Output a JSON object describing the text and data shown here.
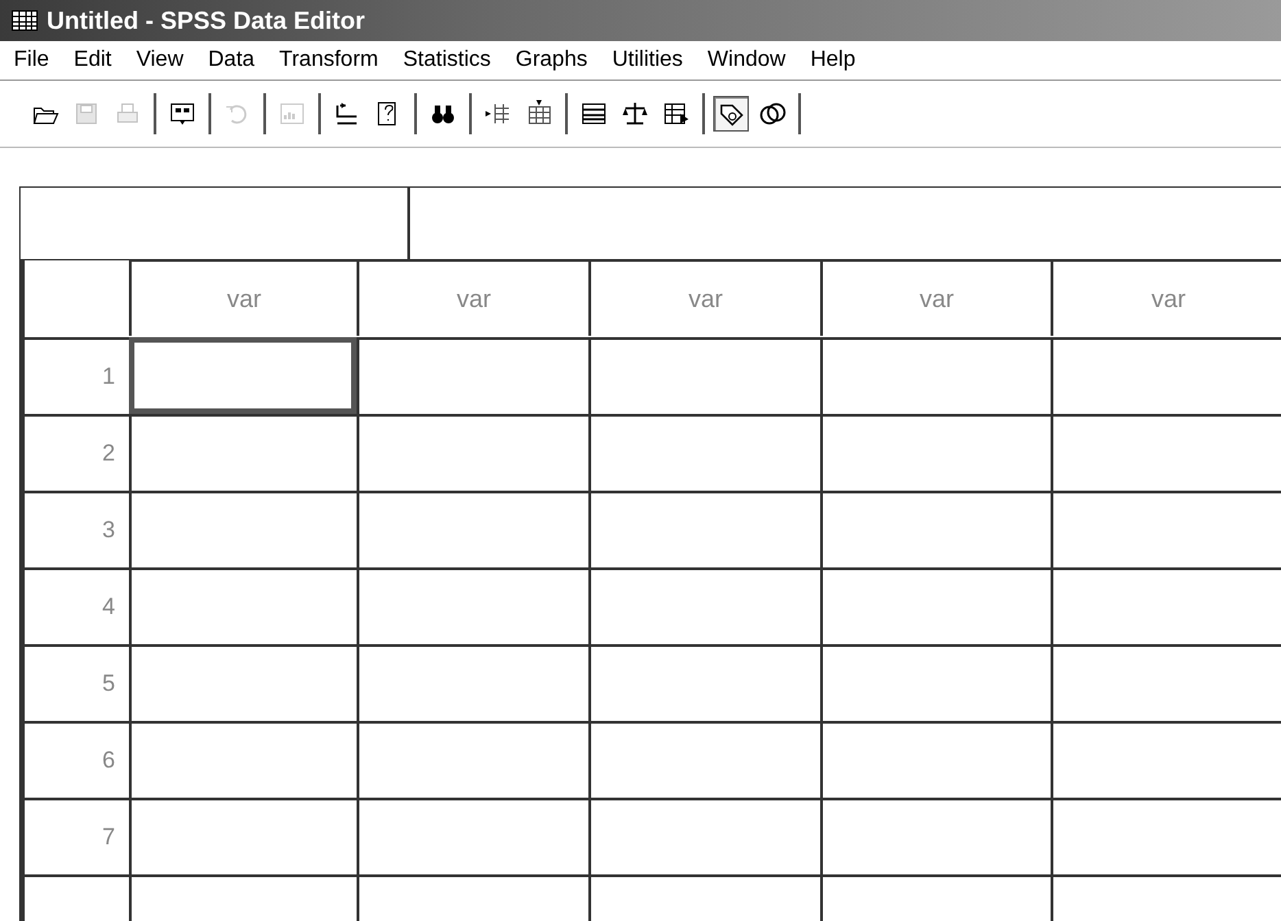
{
  "window": {
    "title": "Untitled - SPSS Data Editor"
  },
  "menu": [
    "File",
    "Edit",
    "View",
    "Data",
    "Transform",
    "Statistics",
    "Graphs",
    "Utilities",
    "Window",
    "Help"
  ],
  "toolbar": [
    [
      {
        "disabled": false,
        "pressed": false
      },
      {
        "disabled": true,
        "pressed": false
      },
      {
        "disabled": true,
        "pressed": false
      }
    ],
    [
      {
        "disabled": false,
        "pressed": false
      }
    ],
    [
      {
        "disabled": true,
        "pressed": false
      }
    ],
    [
      {
        "disabled": true,
        "pressed": false
      }
    ],
    [
      {
        "disabled": false,
        "pressed": false
      },
      {
        "disabled": false,
        "pressed": false
      }
    ],
    [
      {
        "disabled": false,
        "pressed": false
      }
    ],
    [
      {
        "disabled": false,
        "pressed": false
      },
      {
        "disabled": false,
        "pressed": false
      }
    ],
    [
      {
        "disabled": false,
        "pressed": false
      },
      {
        "disabled": false,
        "pressed": false
      },
      {
        "disabled": false,
        "pressed": false
      }
    ],
    [
      {
        "disabled": false,
        "pressed": true
      },
      {
        "disabled": false,
        "pressed": false
      }
    ]
  ],
  "grid": {
    "columns": [
      "var",
      "var",
      "var",
      "var",
      "var"
    ],
    "rows": [
      {
        "label": "1",
        "cells": [
          {
            "selected": true
          },
          {
            "selected": false
          },
          {
            "selected": false
          },
          {
            "selected": false
          },
          {
            "selected": false
          }
        ]
      },
      {
        "label": "2",
        "cells": [
          {
            "selected": false
          },
          {
            "selected": false
          },
          {
            "selected": false
          },
          {
            "selected": false
          },
          {
            "selected": false
          }
        ]
      },
      {
        "label": "3",
        "cells": [
          {
            "selected": false
          },
          {
            "selected": false
          },
          {
            "selected": false
          },
          {
            "selected": false
          },
          {
            "selected": false
          }
        ]
      },
      {
        "label": "4",
        "cells": [
          {
            "selected": false
          },
          {
            "selected": false
          },
          {
            "selected": false
          },
          {
            "selected": false
          },
          {
            "selected": false
          }
        ]
      },
      {
        "label": "5",
        "cells": [
          {
            "selected": false
          },
          {
            "selected": false
          },
          {
            "selected": false
          },
          {
            "selected": false
          },
          {
            "selected": false
          }
        ]
      },
      {
        "label": "6",
        "cells": [
          {
            "selected": false
          },
          {
            "selected": false
          },
          {
            "selected": false
          },
          {
            "selected": false
          },
          {
            "selected": false
          }
        ]
      },
      {
        "label": "7",
        "cells": [
          {
            "selected": false
          },
          {
            "selected": false
          },
          {
            "selected": false
          },
          {
            "selected": false
          },
          {
            "selected": false
          }
        ]
      }
    ]
  }
}
